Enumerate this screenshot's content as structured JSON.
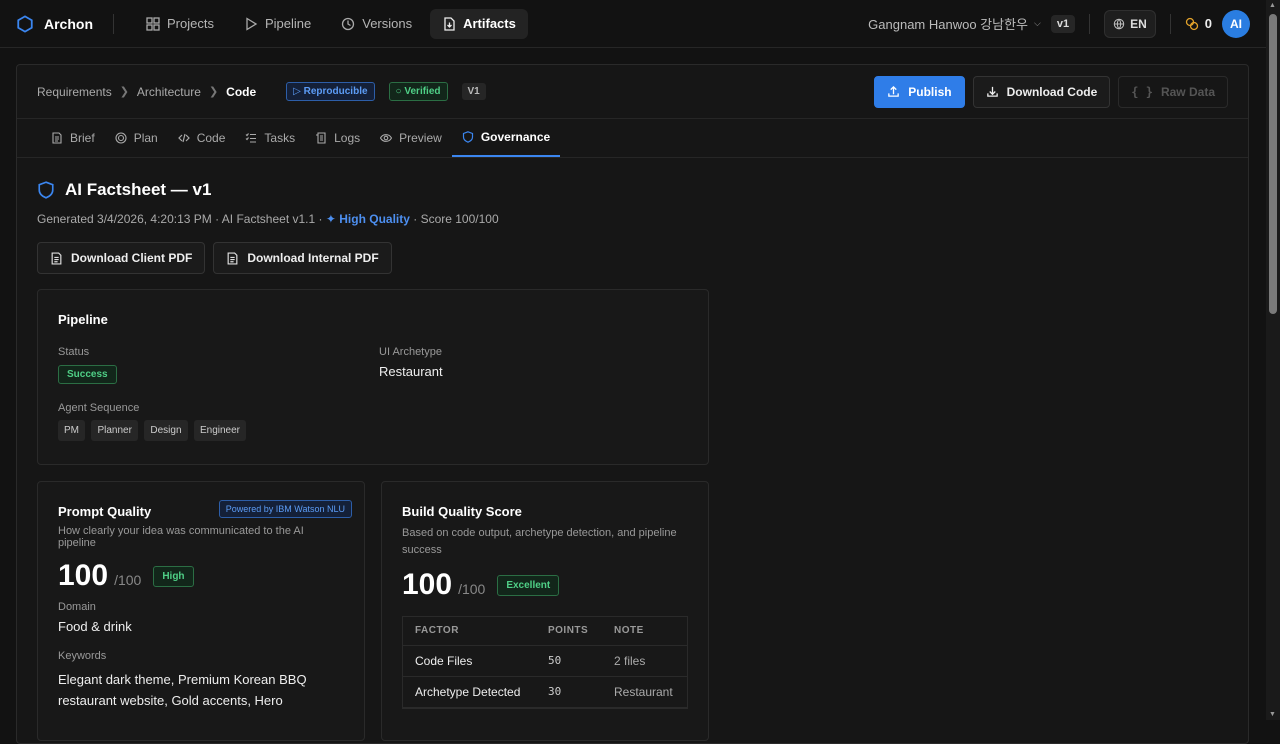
{
  "nav": {
    "brand": "Archon",
    "items": [
      {
        "label": "Projects",
        "icon": "grid-icon"
      },
      {
        "label": "Pipeline",
        "icon": "play-icon"
      },
      {
        "label": "Versions",
        "icon": "clock-icon"
      },
      {
        "label": "Artifacts",
        "icon": "file-download-icon",
        "active": true
      }
    ],
    "project_name": "Gangnam Hanwoo 강남한우",
    "project_version": "v1",
    "language": "EN",
    "credits": "0",
    "avatar_initials": "AI"
  },
  "header": {
    "breadcrumbs": [
      "Requirements",
      "Architecture",
      "Code"
    ],
    "badges": {
      "reproducible": "Reproducible",
      "verified": "Verified",
      "version": "V1"
    },
    "actions": {
      "publish": "Publish",
      "download_code": "Download Code",
      "raw_data": "Raw Data"
    }
  },
  "tabs": [
    "Brief",
    "Plan",
    "Code",
    "Tasks",
    "Logs",
    "Preview",
    "Governance"
  ],
  "active_tab": "Governance",
  "factsheet": {
    "title": "AI Factsheet — v1",
    "meta_prefix": "Generated 3/4/2026, 4:20:13 PM · AI Factsheet v1.1 · ",
    "quality_label": "High Quality",
    "meta_suffix": " · Score 100/100",
    "download_client": "Download Client PDF",
    "download_internal": "Download Internal PDF"
  },
  "pipeline": {
    "title": "Pipeline",
    "status_label": "Status",
    "status_value": "Success",
    "archetype_label": "UI Archetype",
    "archetype_value": "Restaurant",
    "agent_label": "Agent Sequence",
    "agents": [
      "PM",
      "Planner",
      "Design",
      "Engineer"
    ]
  },
  "prompt_quality": {
    "title": "Prompt Quality",
    "powered_by": "Powered by IBM Watson NLU",
    "subtitle": "How clearly your idea was communicated to the AI pipeline",
    "score": "100",
    "out_of": "/100",
    "rating": "High",
    "domain_label": "Domain",
    "domain_value": "Food & drink",
    "keywords_label": "Keywords",
    "keywords_value": "Elegant dark theme, Premium Korean BBQ restaurant website, Gold accents, Hero"
  },
  "build_quality": {
    "title": "Build Quality Score",
    "subtitle": "Based on code output, archetype detection, and pipeline success",
    "score": "100",
    "out_of": "/100",
    "rating": "Excellent",
    "table_headers": [
      "FACTOR",
      "POINTS",
      "NOTE"
    ],
    "rows": [
      {
        "factor": "Code Files",
        "points": "50",
        "note": "2 files"
      },
      {
        "factor": "Archetype Detected",
        "points": "30",
        "note": "Restaurant"
      }
    ]
  }
}
